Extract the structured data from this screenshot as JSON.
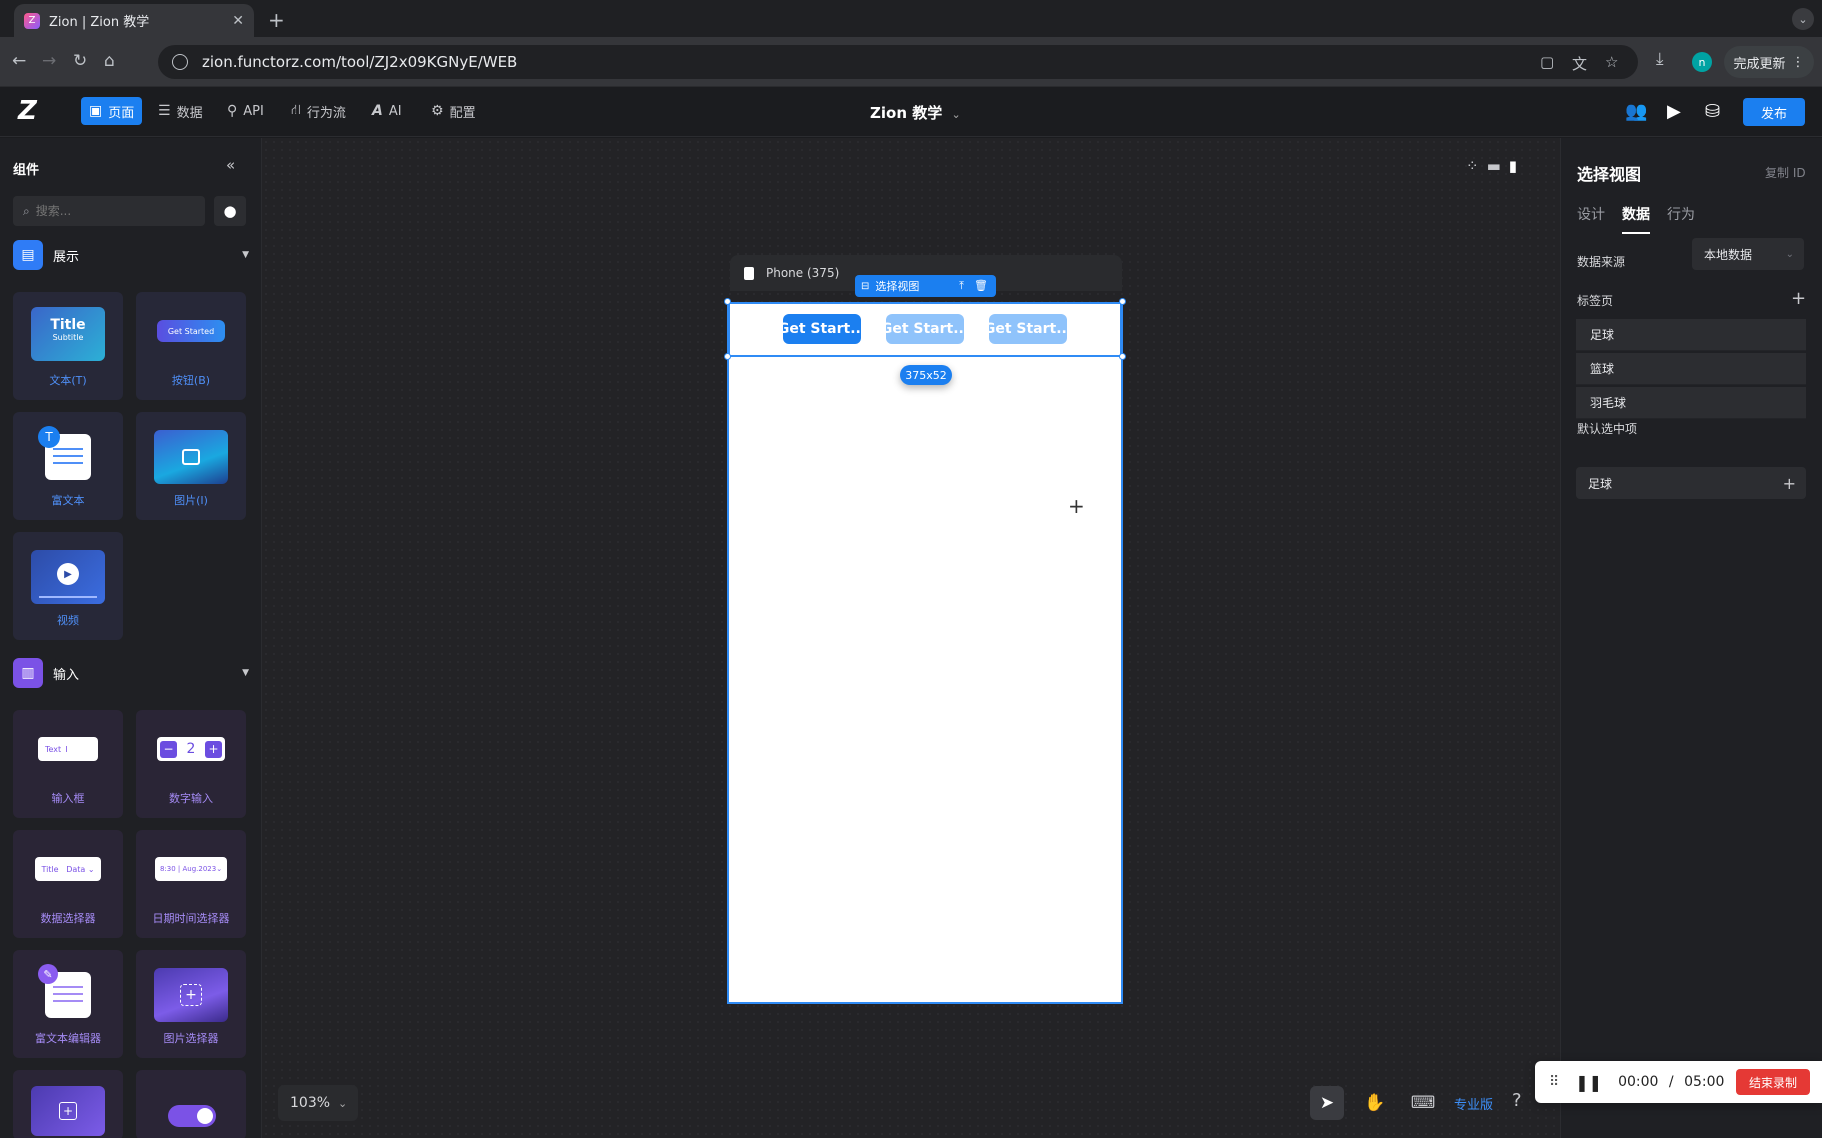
{
  "browser": {
    "tab_title": "Zion | Zion 教学",
    "url": "zion.functorz.com/tool/ZJ2x09KGNyE/WEB",
    "profile_initial": "n",
    "update_label": "完成更新"
  },
  "header": {
    "nav": [
      {
        "label": "页面",
        "icon": "page-icon"
      },
      {
        "label": "数据",
        "icon": "database-icon"
      },
      {
        "label": "API",
        "icon": "api-icon"
      },
      {
        "label": "行为流",
        "icon": "flow-icon"
      },
      {
        "label": "AI",
        "icon": "ai-icon"
      },
      {
        "label": "配置",
        "icon": "gear-icon"
      }
    ],
    "project_name": "Zion 教学",
    "publish_label": "发布"
  },
  "left_panel": {
    "title": "组件",
    "search_placeholder": "搜索...",
    "sections": [
      {
        "name": "展示",
        "items": [
          {
            "label": "文本(T)",
            "thumb_title": "Title",
            "thumb_sub": "Subtitle"
          },
          {
            "label": "按钮(B)",
            "thumb_text": "Get Started"
          },
          {
            "label": "富文本",
            "thumb_badge": "T"
          },
          {
            "label": "图片(I)"
          },
          {
            "label": "视频"
          }
        ]
      },
      {
        "name": "输入",
        "items": [
          {
            "label": "输入框",
            "thumb_text": "Text"
          },
          {
            "label": "数字输入",
            "thumb_text": "2"
          },
          {
            "label": "数据选择器",
            "thumb_text": "Title   Data"
          },
          {
            "label": "日期时间选择器",
            "thumb_text": "8:30 | Aug.2023"
          },
          {
            "label": "富文本编辑器"
          },
          {
            "label": "图片选择器"
          }
        ]
      }
    ]
  },
  "canvas": {
    "device_label": "Phone (375)",
    "selection_label": "选择视图",
    "size_badge": "375x52",
    "tab_buttons": [
      "Get Start...",
      "Get Start...",
      "Get Start..."
    ],
    "zoom": "103%",
    "pro_label": "专业版"
  },
  "right_panel": {
    "title": "选择视图",
    "copy_id": "复制 ID",
    "tabs": [
      "设计",
      "数据",
      "行为"
    ],
    "active_tab": "数据",
    "data_source_label": "数据来源",
    "data_source_value": "本地数据",
    "tabs_label": "标签页",
    "tab_items": [
      "足球",
      "篮球",
      "羽毛球"
    ],
    "default_label": "默认选中项",
    "default_value": "足球"
  },
  "recorder": {
    "elapsed": "00:00",
    "separator": "/",
    "total": "05:00",
    "stop_label": "结束录制"
  },
  "colors": {
    "accent": "#1b7ff0",
    "record_stop": "#e53935"
  }
}
